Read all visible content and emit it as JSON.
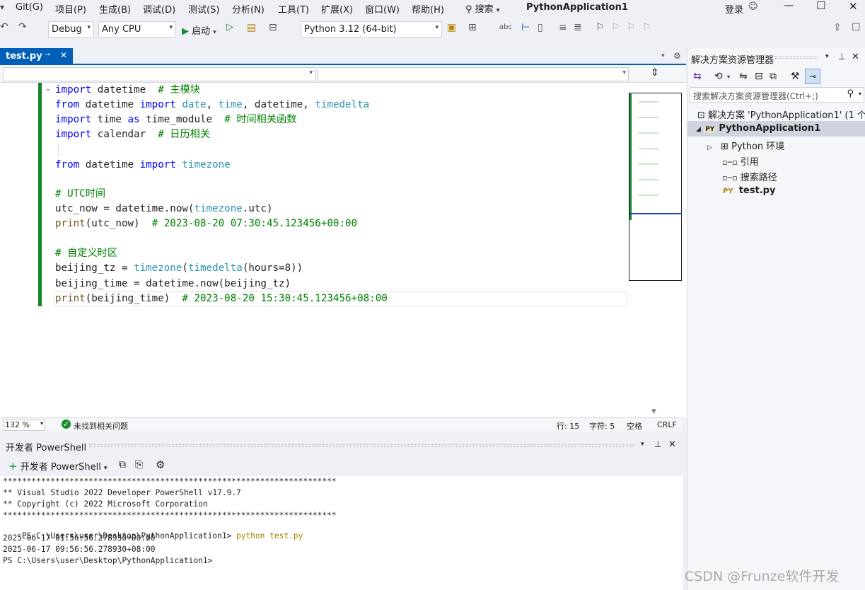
{
  "menu": {
    "items": [
      "Git(G)",
      "项目(P)",
      "生成(B)",
      "调试(D)",
      "测试(S)",
      "分析(N)",
      "工具(T)",
      "扩展(X)",
      "窗口(W)",
      "帮助(H)"
    ],
    "search_label": "搜索",
    "app_title": "PythonApplication1",
    "login": "登录"
  },
  "toolbar": {
    "config": "Debug",
    "platform": "Any CPU",
    "start_label": "启动",
    "python_env": "Python 3.12 (64-bit)"
  },
  "editor": {
    "tab_label": "test.py",
    "lines": [
      {
        "tokens": [
          {
            "t": "import",
            "c": "kw"
          },
          {
            "t": " datetime  "
          },
          {
            "t": "# 主模块",
            "c": "cmt"
          }
        ]
      },
      {
        "tokens": [
          {
            "t": "from",
            "c": "kw"
          },
          {
            "t": " datetime "
          },
          {
            "t": "import",
            "c": "kw"
          },
          {
            "t": " "
          },
          {
            "t": "date",
            "c": "cls"
          },
          {
            "t": ", "
          },
          {
            "t": "time",
            "c": "cls"
          },
          {
            "t": ", datetime, "
          },
          {
            "t": "timedelta",
            "c": "cls"
          }
        ]
      },
      {
        "tokens": [
          {
            "t": "import",
            "c": "kw"
          },
          {
            "t": " time "
          },
          {
            "t": "as",
            "c": "kw"
          },
          {
            "t": " time_module  "
          },
          {
            "t": "# 时间相关函数",
            "c": "cmt"
          }
        ]
      },
      {
        "tokens": [
          {
            "t": "import",
            "c": "kw"
          },
          {
            "t": " calendar  "
          },
          {
            "t": "# 日历相关",
            "c": "cmt"
          }
        ]
      },
      {
        "tokens": [
          {
            "t": ""
          }
        ]
      },
      {
        "tokens": [
          {
            "t": "from",
            "c": "kw"
          },
          {
            "t": " datetime "
          },
          {
            "t": "import",
            "c": "kw"
          },
          {
            "t": " "
          },
          {
            "t": "timezone",
            "c": "cls"
          }
        ]
      },
      {
        "tokens": [
          {
            "t": ""
          }
        ]
      },
      {
        "tokens": [
          {
            "t": "# UTC时间",
            "c": "cmt"
          }
        ]
      },
      {
        "tokens": [
          {
            "t": "utc_now = datetime.now("
          },
          {
            "t": "timezone",
            "c": "cls"
          },
          {
            "t": ".utc)"
          }
        ]
      },
      {
        "tokens": [
          {
            "t": "print",
            "c": "fn"
          },
          {
            "t": "(utc_now)  "
          },
          {
            "t": "# 2023-08-20 07:30:45.123456+00:00",
            "c": "cmt"
          }
        ]
      },
      {
        "tokens": [
          {
            "t": ""
          }
        ]
      },
      {
        "tokens": [
          {
            "t": "# 自定义时区",
            "c": "cmt"
          }
        ]
      },
      {
        "tokens": [
          {
            "t": "beijing_tz = "
          },
          {
            "t": "timezone",
            "c": "cls"
          },
          {
            "t": "("
          },
          {
            "t": "timedelta",
            "c": "cls"
          },
          {
            "t": "(hours=8))"
          }
        ]
      },
      {
        "tokens": [
          {
            "t": "beijing_time = datetime.now(beijing_tz)"
          }
        ]
      },
      {
        "tokens": [
          {
            "t": "print",
            "c": "fn"
          },
          {
            "t": "(beijing_time)  "
          },
          {
            "t": "# 2023-08-20 15:30:45.123456+08:00",
            "c": "cmt"
          }
        ]
      }
    ]
  },
  "status": {
    "zoom": "132 %",
    "issues": "未找到相关问题",
    "line": "行: 15",
    "col": "字符: 5",
    "spaces": "空格",
    "eol": "CRLF"
  },
  "terminal": {
    "panel_title": "开发者 PowerShell",
    "new_label": "开发者 PowerShell",
    "lines": [
      "**********************************************************************",
      "** Visual Studio 2022 Developer PowerShell v17.9.7",
      "** Copyright (c) 2022 Microsoft Corporation",
      "**********************************************************************",
      "PS C:\\Users\\user\\Desktop\\PythonApplication1> ",
      "2025-06-17 01:56:56.278930+00:00",
      "2025-06-17 09:56:56.278930+08:00",
      "PS C:\\Users\\user\\Desktop\\PythonApplication1>"
    ],
    "command": "python test.py"
  },
  "solution_explorer": {
    "title": "解决方案资源管理器",
    "search_placeholder": "搜索解决方案资源管理器(Ctrl+;)",
    "solution_label": "解决方案 'PythonApplication1' (1 个",
    "project_label": "PythonApplication1",
    "items": [
      "Python 环境",
      "引用",
      "搜索路径",
      "test.py"
    ]
  },
  "watermark": "CSDN @Frunze软件开发"
}
